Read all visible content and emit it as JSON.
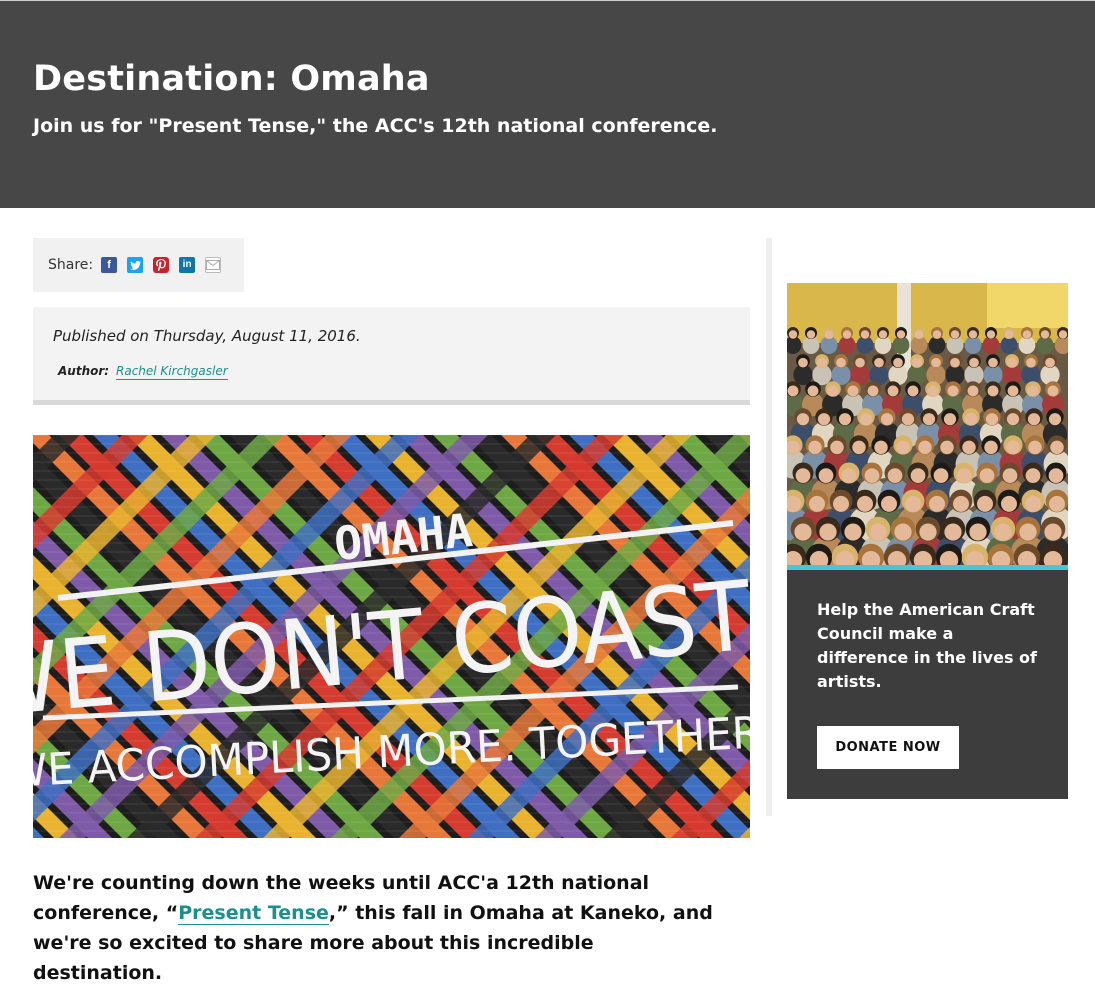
{
  "header": {
    "title": "Destination: Omaha",
    "subtitle": "Join us for \"Present Tense,\" the ACC's 12th national conference."
  },
  "share": {
    "label": "Share:",
    "icons": [
      "facebook-icon",
      "twitter-icon",
      "pinterest-icon",
      "linkedin-icon",
      "email-icon"
    ]
  },
  "meta": {
    "published": "Published on Thursday, August 11, 2016.",
    "author_label": "Author:",
    "author_name": "Rachel Kirchgasler"
  },
  "mural": {
    "line1": "OMAHA",
    "line2": "WE DON'T COAST",
    "line3": "WE ACCOMPLISH MORE. TOGETHER."
  },
  "article": {
    "text_before": "We're counting down the weeks until ACC'a 12th national conference, “",
    "link": "Present Tense",
    "text_after": ",” this fall in Omaha at Kaneko, and we're so excited to share more about this incredible destination."
  },
  "promo": {
    "text": "Help the American Craft Council make a difference in the lives of artists.",
    "button": "DONATE NOW"
  },
  "colors": {
    "header_bg": "#474747",
    "link": "#1c8f8f",
    "promo_bg": "#3d3d3d",
    "promo_accent": "#4cc3d9"
  }
}
